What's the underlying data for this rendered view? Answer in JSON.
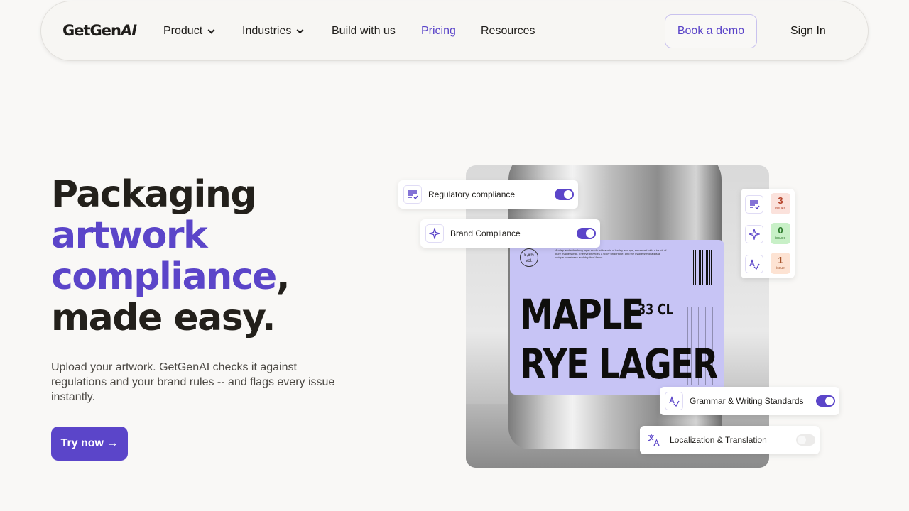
{
  "nav": {
    "logo_main": "GetGen",
    "logo_accent": "AI",
    "items": [
      {
        "label": "Product",
        "dropdown": true
      },
      {
        "label": "Industries",
        "dropdown": true
      },
      {
        "label": "Build with us",
        "dropdown": false
      },
      {
        "label": "Pricing",
        "dropdown": false,
        "active": true
      },
      {
        "label": "Resources",
        "dropdown": false
      }
    ],
    "demo_label": "Book a demo",
    "signin_label": "Sign In"
  },
  "hero": {
    "line1": "Packaging",
    "line2": "artwork",
    "line3": "compliance",
    "line3_suffix": ",",
    "line4": "made easy.",
    "subtitle": "Upload your artwork. GetGenAI checks it against regulations and your brand rules -- and flags every issue instantly.",
    "cta_label": "Try now →"
  },
  "product_label": {
    "volume": "5,6% vol.",
    "description": "A crisp and refreshing lager made with a mix of barley and rye, enhanced with a touch of pure maple syrup. The rye provides a spicy undertone, and the maple syrup adds a unique sweetness and depth of flavor.",
    "name_line1": "MAPLE",
    "name_line2": "RYE LAGER",
    "size": "33 CL"
  },
  "checks": [
    {
      "label": "Regulatory compliance",
      "icon": "list-check-icon",
      "enabled": true
    },
    {
      "label": "Brand Compliance",
      "icon": "sparkle-icon",
      "enabled": true
    },
    {
      "label": "Grammar & Writing Standards",
      "icon": "spellcheck-icon",
      "enabled": true
    },
    {
      "label": "Localization & Translation",
      "icon": "translate-icon",
      "enabled": false
    }
  ],
  "issues": [
    {
      "icon": "list-check-icon",
      "count": "3",
      "unit": "issues",
      "color": "#fbe2dc"
    },
    {
      "icon": "sparkle-icon",
      "count": "0",
      "unit": "issues",
      "color": "#c8f0c7"
    },
    {
      "icon": "spellcheck-icon",
      "count": "1",
      "unit": "issue",
      "color": "#fde3d3"
    }
  ],
  "colors": {
    "accent": "#5b45c9",
    "background": "#f9f8f6"
  }
}
